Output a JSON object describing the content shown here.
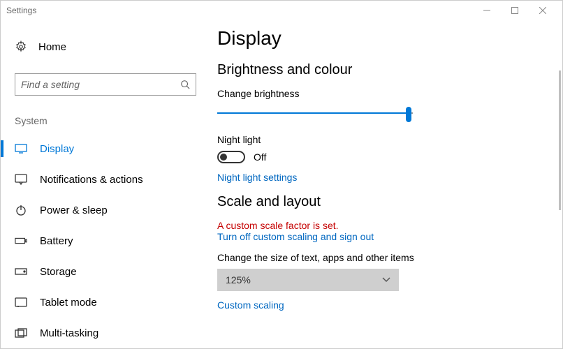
{
  "window": {
    "title": "Settings"
  },
  "sidebar": {
    "home": "Home",
    "search_placeholder": "Find a setting",
    "section": "System",
    "items": [
      {
        "label": "Display",
        "active": true
      },
      {
        "label": "Notifications & actions"
      },
      {
        "label": "Power & sleep"
      },
      {
        "label": "Battery"
      },
      {
        "label": "Storage"
      },
      {
        "label": "Tablet mode"
      },
      {
        "label": "Multi-tasking"
      }
    ]
  },
  "content": {
    "heading": "Display",
    "brightness_section": "Brightness and colour",
    "brightness_label": "Change brightness",
    "brightness_value": 98,
    "night_light_label": "Night light",
    "night_light_state": "Off",
    "night_light_link": "Night light settings",
    "scale_section": "Scale and layout",
    "scale_warning": "A custom scale factor is set.",
    "scale_turn_off_link": "Turn off custom scaling and sign out",
    "scale_label": "Change the size of text, apps and other items",
    "scale_value": "125%",
    "custom_scaling_link": "Custom scaling"
  }
}
